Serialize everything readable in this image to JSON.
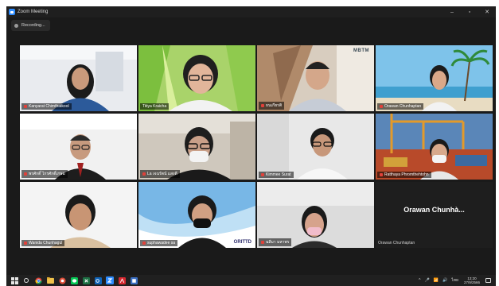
{
  "window": {
    "title": "Zoom Meeting",
    "controls": [
      "–",
      "▫",
      "✕"
    ]
  },
  "recording": {
    "label": "Recording..."
  },
  "participants": [
    {
      "name": "Kanyarat Chimthatkool"
    },
    {
      "name": "Titiya Kraicha"
    },
    {
      "name": "ธนเกียรติ"
    },
    {
      "name": "Orawan Chunhaptan"
    },
    {
      "name": "พรศักดิ์ ไกรศักดิ์เกษม"
    },
    {
      "name": "La เจนรัตน์ แสงดี"
    },
    {
      "name": "Kimmee Surat"
    },
    {
      "name": "Ratthaya Phromthehtohn"
    },
    {
      "name": "Wanida Chunhagul"
    },
    {
      "name": "suphawadee sa"
    },
    {
      "name": "ฉลีมา มหาพร"
    },
    {
      "name": "Orawan Chunhaptan",
      "nocam_label": "Orawan Chunhà..."
    }
  ],
  "tile_text": {
    "watermark_top": "MBTM",
    "watermark_bottom": "ORITTD"
  },
  "tray": {
    "time": "13:20",
    "date": "27/9/2566",
    "lang": "ไทย",
    "icons": [
      "^",
      "🎤",
      "📶",
      "🔊"
    ]
  }
}
